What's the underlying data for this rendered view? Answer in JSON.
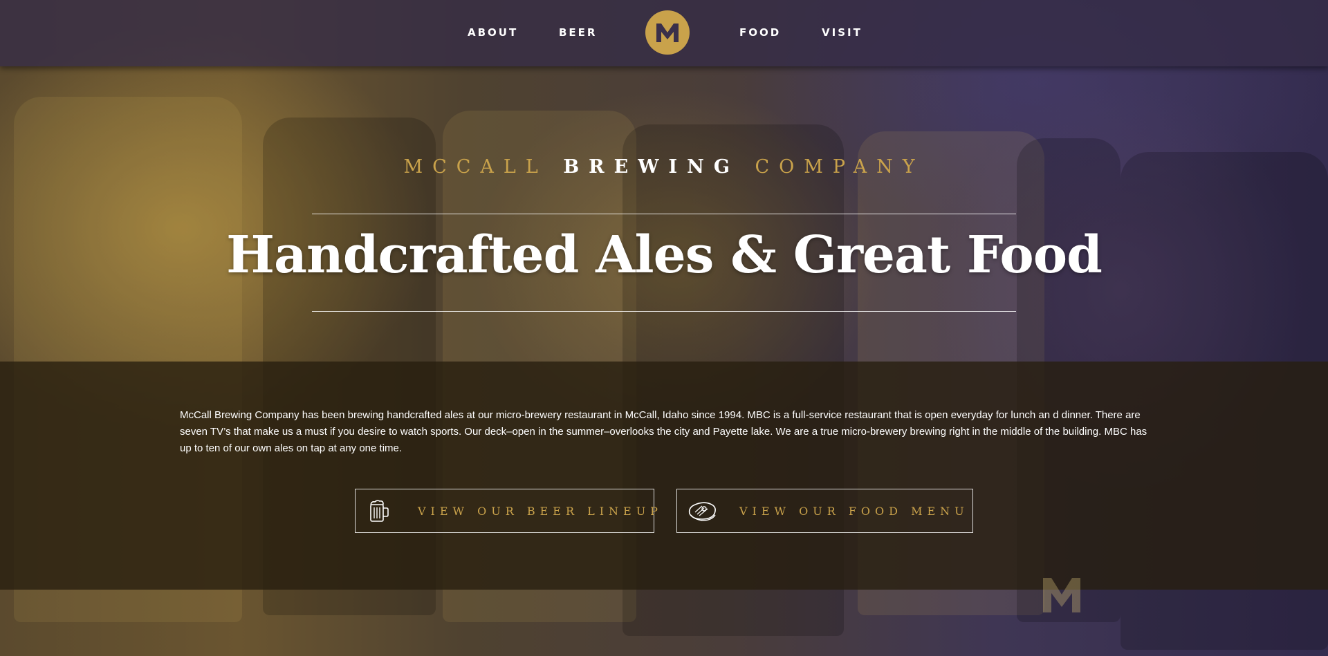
{
  "nav": {
    "items": [
      {
        "label": "ABOUT"
      },
      {
        "label": "BEER"
      },
      {
        "label": "FOOD"
      },
      {
        "label": "VISIT"
      }
    ],
    "logo_letter": "M"
  },
  "hero": {
    "title_part1": "MCCALL",
    "title_part2": "BREWING",
    "title_part3": "COMPANY",
    "headline": "Handcrafted Ales & Great Food"
  },
  "intro": {
    "text": "McCall Brewing Company has been brewing handcrafted ales at our micro-brewery restaurant in McCall, Idaho since 1994. MBC is a full-service restaurant that is open everyday for lunch an d dinner. There are seven TV’s that make us a must if you desire to watch sports. Our deck–open in the summer–overlooks the city and Payette lake. We are a true micro-brewery brewing right in the middle of the building. MBC has up to ten of our own ales on tap at any one time."
  },
  "buttons": {
    "beer": {
      "label": "VIEW OUR BEER LINEUP",
      "icon": "beer-mug-icon"
    },
    "food": {
      "label": "VIEW OUR FOOD MENU",
      "icon": "steak-icon"
    }
  },
  "colors": {
    "accent_gold": "#c9a24b",
    "nav_background": "#342c46",
    "text": "#ffffff"
  }
}
